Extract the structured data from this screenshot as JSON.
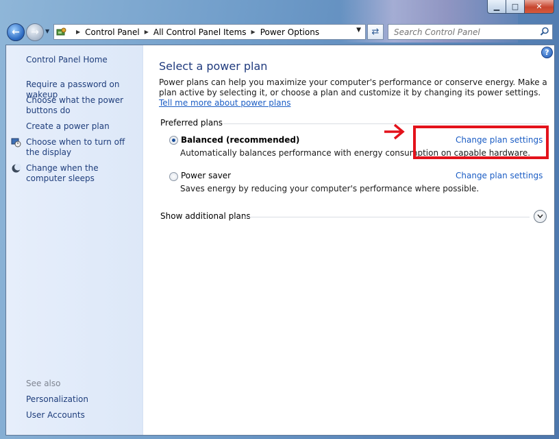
{
  "window": {
    "caption": {
      "minimize": "▁",
      "maximize": "□",
      "close": "✕"
    }
  },
  "navbar": {
    "back_icon": "back-arrow-icon",
    "forward_icon": "forward-arrow-icon",
    "breadcrumb": [
      "Control Panel",
      "All Control Panel Items",
      "Power Options"
    ],
    "search_placeholder": "Search Control Panel"
  },
  "sidebar": {
    "home": "Control Panel Home",
    "links": [
      "Require a password on wakeup",
      "Choose what the power buttons do",
      "Create a power plan",
      "Choose when to turn off the display",
      "Change when the computer sleeps"
    ],
    "see_also_label": "See also",
    "see_also": [
      "Personalization",
      "User Accounts"
    ]
  },
  "main": {
    "help": "?",
    "title": "Select a power plan",
    "description": "Power plans can help you maximize your computer's performance or conserve energy. Make a plan active by selecting it, or choose a plan and customize it by changing its power settings.",
    "tell_me_link": "Tell me more about power plans",
    "preferred_label": "Preferred plans",
    "plans": [
      {
        "name": "Balanced (recommended)",
        "description": "Automatically balances performance with energy consumption on capable hardware.",
        "change_link": "Change plan settings",
        "selected": true
      },
      {
        "name": "Power saver",
        "description": "Saves energy by reducing your computer's performance where possible.",
        "change_link": "Change plan settings",
        "selected": false
      }
    ],
    "show_additional": "Show additional plans"
  },
  "colors": {
    "link": "#1a5cc4",
    "title": "#1f3a7d",
    "highlight": "#e3121b",
    "sidebar_bg": "#dde8f8"
  }
}
